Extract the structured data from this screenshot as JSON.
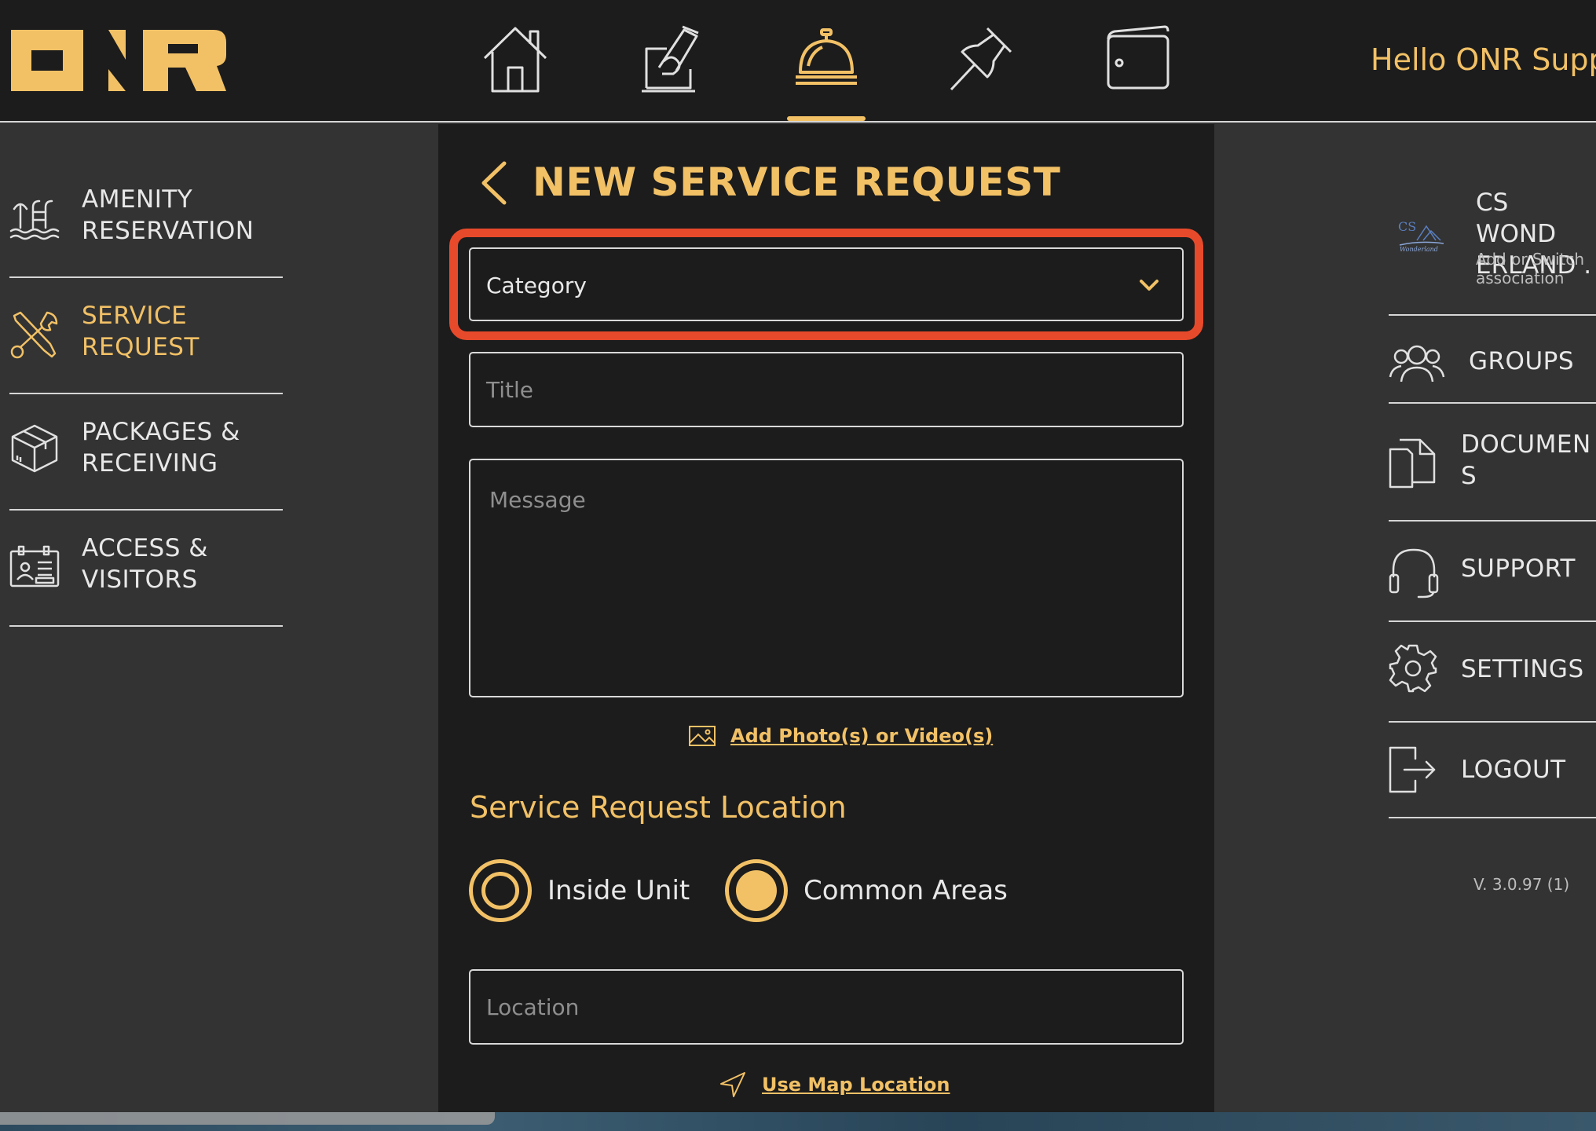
{
  "header": {
    "brand": "ONR",
    "greeting": "Hello ONR Supp",
    "nav": [
      {
        "id": "home",
        "icon": "home-icon"
      },
      {
        "id": "vote",
        "icon": "ballot-box-icon"
      },
      {
        "id": "concierge",
        "icon": "service-bell-icon",
        "active": true
      },
      {
        "id": "board",
        "icon": "pushpin-icon"
      },
      {
        "id": "wallet",
        "icon": "wallet-icon"
      }
    ]
  },
  "left_menu": {
    "items": [
      {
        "label": "AMENITY\nRESERVATION",
        "icon": "pool-ladder-icon"
      },
      {
        "label": "SERVICE\nREQUEST",
        "icon": "wrench-screwdriver-icon",
        "active": true
      },
      {
        "label": "PACKAGES &\nRECEIVING",
        "icon": "package-box-icon"
      },
      {
        "label": "ACCESS &\nVISITORS",
        "icon": "visitor-badge-icon"
      }
    ]
  },
  "form": {
    "title": "NEW SERVICE REQUEST",
    "category_placeholder": "Category",
    "title_placeholder": "Title",
    "message_placeholder": "Message",
    "add_media_label": "Add Photo(s) or Video(s)",
    "location_heading": "Service Request Location",
    "location_options": [
      {
        "label": "Inside Unit",
        "selected": false
      },
      {
        "label": "Common Areas",
        "selected": true
      }
    ],
    "location_placeholder": "Location",
    "map_link_label": "Use Map Location"
  },
  "right_menu": {
    "association_name": "CS WOND\nERLAND .",
    "association_sub": "Add or Switch\nassociation",
    "items": [
      {
        "label": "GROUPS",
        "icon": "groups-icon"
      },
      {
        "label": "DOCUMEN\nS",
        "icon": "documents-icon"
      },
      {
        "label": "SUPPORT",
        "icon": "headset-icon"
      },
      {
        "label": "SETTINGS",
        "icon": "gear-icon"
      },
      {
        "label": "LOGOUT",
        "icon": "logout-icon"
      }
    ],
    "version": "V. 3.0.97 (1)"
  },
  "colors": {
    "accent": "#f2c166",
    "panel": "#1c1c1c",
    "background": "#333333",
    "highlight": "#e74a2b"
  }
}
